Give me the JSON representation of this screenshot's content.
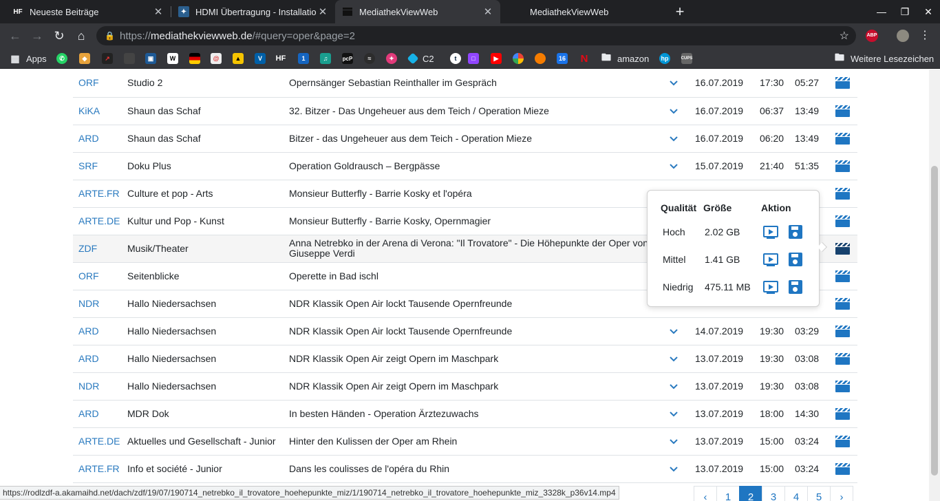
{
  "tabs": [
    {
      "title": "Neueste Beiträge",
      "favicon": "HF"
    },
    {
      "title": "HDMI Übertragung - Installatio",
      "favicon": "forum-icon"
    },
    {
      "title": "MediathekViewWeb",
      "favicon": "clapperboard-icon"
    },
    {
      "title": "MediathekViewWeb",
      "favicon": ""
    }
  ],
  "address": {
    "scheme": "https://",
    "host": "mediathekviewweb.de",
    "path": "/#query=oper&page=2"
  },
  "bookmarks": {
    "apps_label": "Apps",
    "pcp_label": "pcP",
    "c2_label": "C2",
    "hf_label": "HF",
    "cal_label": "16",
    "t_label": "t",
    "amazon_label": "amazon",
    "more_label": "Weitere Lesezeichen",
    "cups_label": "CUPS"
  },
  "extensions": {
    "abp_label": "ABP"
  },
  "rows": [
    {
      "channel": "ORF",
      "topic": "Studio 2",
      "title": "Opernsänger Sebastian Reinthaller im Gespräch",
      "date": "16.07.2019",
      "time": "17:30",
      "duration": "05:27"
    },
    {
      "channel": "KiKA",
      "topic": "Shaun das Schaf",
      "title": "32. Bitzer - Das Ungeheuer aus dem Teich / Operation Mieze",
      "date": "16.07.2019",
      "time": "06:37",
      "duration": "13:49"
    },
    {
      "channel": "ARD",
      "topic": "Shaun das Schaf",
      "title": "Bitzer - das Ungeheuer aus dem Teich - Operation Mieze",
      "date": "16.07.2019",
      "time": "06:20",
      "duration": "13:49"
    },
    {
      "channel": "SRF",
      "topic": "Doku Plus",
      "title": "Operation Goldrausch – Bergpässe",
      "date": "15.07.2019",
      "time": "21:40",
      "duration": "51:35"
    },
    {
      "channel": "ARTE.FR",
      "topic": "Culture et pop - Arts",
      "title": "Monsieur Butterfly - Barrie Kosky et l'opéra",
      "date": "",
      "time": "",
      "duration": ""
    },
    {
      "channel": "ARTE.DE",
      "topic": "Kultur und Pop - Kunst",
      "title": "Monsieur Butterfly - Barrie Kosky, Opernmagier",
      "date": "",
      "time": "",
      "duration": ""
    },
    {
      "channel": "ZDF",
      "topic": "Musik/Theater",
      "title": "Anna Netrebko in der Arena di Verona: \"Il Trovatore\" - Die Höhepunkte der Oper von Giuseppe Verdi",
      "date": "",
      "time": "",
      "duration": ""
    },
    {
      "channel": "ORF",
      "topic": "Seitenblicke",
      "title": "Operette in Bad ischl",
      "date": "",
      "time": "",
      "duration": ""
    },
    {
      "channel": "NDR",
      "topic": "Hallo Niedersachsen",
      "title": "NDR Klassik Open Air lockt Tausende Opernfreunde",
      "date": "",
      "time": "",
      "duration": ""
    },
    {
      "channel": "ARD",
      "topic": "Hallo Niedersachsen",
      "title": "NDR Klassik Open Air lockt Tausende Opernfreunde",
      "date": "14.07.2019",
      "time": "19:30",
      "duration": "03:29"
    },
    {
      "channel": "ARD",
      "topic": "Hallo Niedersachsen",
      "title": "NDR Klassik Open Air zeigt Opern im Maschpark",
      "date": "13.07.2019",
      "time": "19:30",
      "duration": "03:08"
    },
    {
      "channel": "NDR",
      "topic": "Hallo Niedersachsen",
      "title": "NDR Klassik Open Air zeigt Opern im Maschpark",
      "date": "13.07.2019",
      "time": "19:30",
      "duration": "03:08"
    },
    {
      "channel": "ARD",
      "topic": "MDR Dok",
      "title": "In besten Händen - Operation Ärztezuwachs",
      "date": "13.07.2019",
      "time": "18:00",
      "duration": "14:30"
    },
    {
      "channel": "ARTE.DE",
      "topic": "Aktuelles und Gesellschaft - Junior",
      "title": "Hinter den Kulissen der Oper am Rhein",
      "date": "13.07.2019",
      "time": "15:00",
      "duration": "03:24"
    },
    {
      "channel": "ARTE.FR",
      "topic": "Info et société - Junior",
      "title": "Dans les coulisses de l'opéra du Rhin",
      "date": "13.07.2019",
      "time": "15:00",
      "duration": "03:24"
    }
  ],
  "popover": {
    "headers": {
      "quality": "Qualität",
      "size": "Größe",
      "action": "Aktion"
    },
    "rows": [
      {
        "quality": "Hoch",
        "size": "2.02 GB"
      },
      {
        "quality": "Mittel",
        "size": "1.41 GB"
      },
      {
        "quality": "Niedrig",
        "size": "475.11 MB"
      }
    ]
  },
  "status_url": "https://rodlzdf-a.akamaihd.net/dach/zdf/19/07/190714_netrebko_il_trovatore_hoehepunkte_miz/1/190714_netrebko_il_trovatore_hoehepunkte_miz_3328k_p36v14.mp4",
  "pagination": {
    "prev": "‹",
    "pages": [
      "1",
      "2",
      "3",
      "4",
      "5"
    ],
    "active": "2",
    "next": "›"
  },
  "colors": {
    "accent": "#1f76c2",
    "chrome_dark": "#202124",
    "chrome": "#35363a"
  }
}
